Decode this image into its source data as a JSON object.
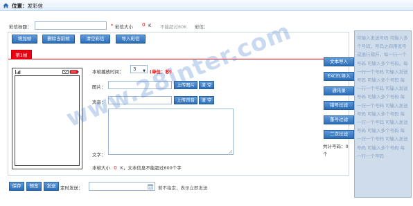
{
  "header": {
    "location_label": "位置：",
    "location_value": "发彩信"
  },
  "subject": {
    "label": "彩信标题：",
    "value": "",
    "required_mark": "*",
    "size_label": "彩信大小",
    "size_value": "0",
    "size_unit": "K",
    "limit_text": "不能超过80K",
    "note_label": "彩信："
  },
  "toolbar": {
    "add_frame": "增加帧",
    "delete_frame": "删除当前帧",
    "clear_mms": "清空彩信",
    "import_mms": "导入彩信"
  },
  "tabs": [
    {
      "label": "第1帧",
      "active": true
    }
  ],
  "frame": {
    "duration_label": "本帧播放时间：",
    "duration_value": "3",
    "duration_unit": "(单位：秒)",
    "image_label": "图片：",
    "upload_image": "上传图片",
    "clear_image": "清 空",
    "sound_label": "声音：",
    "upload_sound": "上传声音",
    "clear_sound": "清 空",
    "text_label": "文字：",
    "text_value": "",
    "size_prefix": "本帧大小",
    "size_value": "0",
    "size_suffix": "K，文本信息不能超过600个字"
  },
  "bottom": {
    "save": "保存",
    "preview": "预览",
    "send": "发送",
    "schedule_label": "定时发送：",
    "schedule_value": "",
    "schedule_hint": "若不指定，表示立即发送"
  },
  "side_buttons": {
    "text_import": "文本导入",
    "excel_import": "EXCEL导入",
    "address_book": "通讯录",
    "filter_invalid": "错号过滤",
    "filter_duplicate": "重号过滤",
    "secondary_filter": "二次过滤"
  },
  "count": {
    "label": "共计号码：",
    "value": "0",
    "unit": "个"
  },
  "recipients": {
    "placeholder": "可输入发送号码 可输入多个号码，号码之间用逗号或换行隔开，每一行一个号码 可输入多个号码，每一行一个号码 可输入发送号码 可输入多个号码 每一行一个号码 可输入发送号码 可输入多个号码 每一行一个号码 可输入发送号码 可输入多个号码 每一行一个号码 可输入发送号码 可输入多个号码 每一行一个号码 可输入发送号码 可输入多个号码 每一行一个号码"
  },
  "watermark": "www.28inter.com",
  "colors": {
    "accent_red": "#e60012",
    "button_blue": "#2c6db7",
    "panel_bg": "#cfdcec"
  }
}
